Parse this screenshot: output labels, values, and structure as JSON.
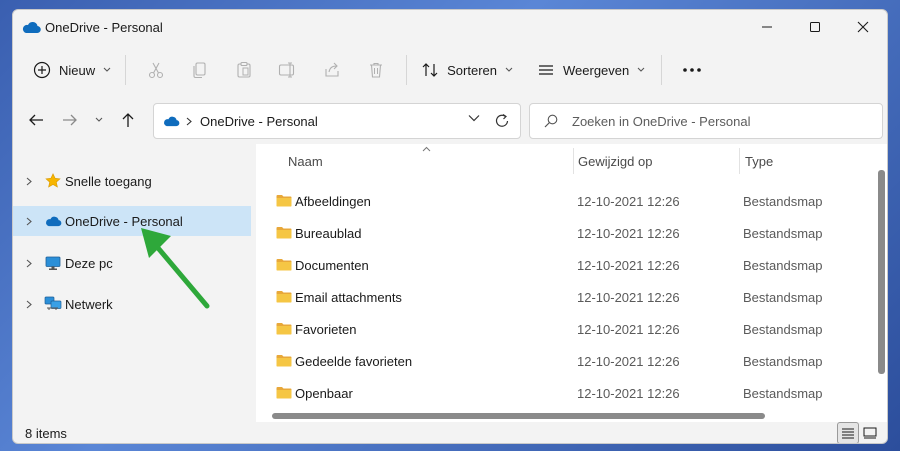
{
  "window": {
    "title": "OneDrive - Personal"
  },
  "toolbar": {
    "new_label": "Nieuw",
    "sort_label": "Sorteren",
    "view_label": "Weergeven"
  },
  "address": {
    "crumb": "OneDrive - Personal"
  },
  "search": {
    "placeholder": "Zoeken in OneDrive - Personal"
  },
  "nav": {
    "items": [
      {
        "label": "Snelle toegang",
        "icon": "star-icon"
      },
      {
        "label": "OneDrive - Personal",
        "icon": "cloud-icon",
        "selected": true
      },
      {
        "label": "Deze pc",
        "icon": "monitor-icon"
      },
      {
        "label": "Netwerk",
        "icon": "network-icon"
      }
    ]
  },
  "columns": {
    "name": "Naam",
    "modified": "Gewijzigd op",
    "type": "Type"
  },
  "files": [
    {
      "name": "Afbeeldingen",
      "modified": "12-10-2021 12:26",
      "type": "Bestandsmap"
    },
    {
      "name": "Bureaublad",
      "modified": "12-10-2021 12:26",
      "type": "Bestandsmap"
    },
    {
      "name": "Documenten",
      "modified": "12-10-2021 12:26",
      "type": "Bestandsmap"
    },
    {
      "name": "Email attachments",
      "modified": "12-10-2021 12:26",
      "type": "Bestandsmap"
    },
    {
      "name": "Favorieten",
      "modified": "12-10-2021 12:26",
      "type": "Bestandsmap"
    },
    {
      "name": "Gedeelde favorieten",
      "modified": "12-10-2021 12:26",
      "type": "Bestandsmap"
    },
    {
      "name": "Openbaar",
      "modified": "12-10-2021 12:26",
      "type": "Bestandsmap"
    }
  ],
  "status": {
    "count": "8 items"
  },
  "colors": {
    "selection": "#cce4f7",
    "onedrive_blue": "#0f6cbd",
    "folder_yellow": "#f5c644",
    "annotation_arrow": "#2ea83a"
  }
}
